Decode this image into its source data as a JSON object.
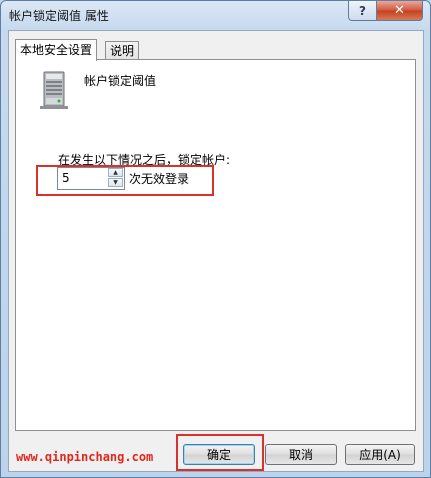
{
  "window": {
    "title": "帐户锁定阈值 属性",
    "help_label": "?",
    "close_label": "✕"
  },
  "tabs": [
    {
      "label": "本地安全设置"
    },
    {
      "label": "说明"
    }
  ],
  "policy": {
    "name": "帐户锁定阈值",
    "lockout_label": "在发生以下情况之后，锁定帐户:",
    "threshold_value": "5",
    "threshold_unit": "次无效登录"
  },
  "watermark": "www.qinpinchang.com",
  "buttons": {
    "ok": "确定",
    "cancel": "取消",
    "apply": "应用(A)"
  },
  "colors": {
    "highlight": "#d9322c",
    "watermark": "#e0281e"
  },
  "icons": {
    "policy_icon": "server-icon",
    "spin_up": "up-arrow-icon",
    "spin_down": "down-arrow-icon"
  }
}
